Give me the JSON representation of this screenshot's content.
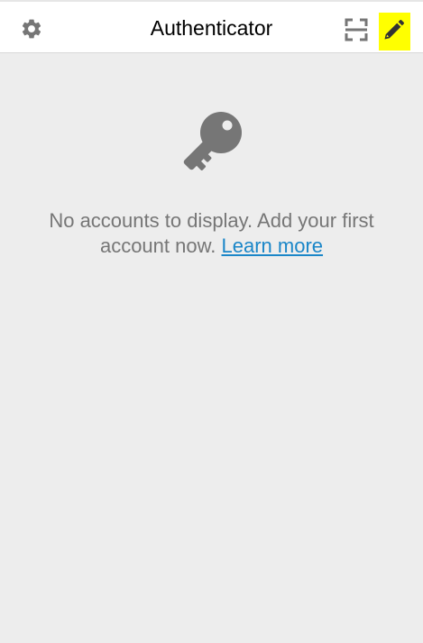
{
  "header": {
    "title": "Authenticator"
  },
  "icons": {
    "settings": "gear-icon",
    "scan": "scan-qr-icon",
    "edit": "pencil-icon",
    "empty": "key-icon"
  },
  "colors": {
    "highlight": "#ffff00",
    "link": "#1a86c8",
    "icon": "#767676",
    "background": "#ededed"
  },
  "empty_state": {
    "message": "No accounts to display. Add your first account now.",
    "link_label": "Learn more"
  }
}
